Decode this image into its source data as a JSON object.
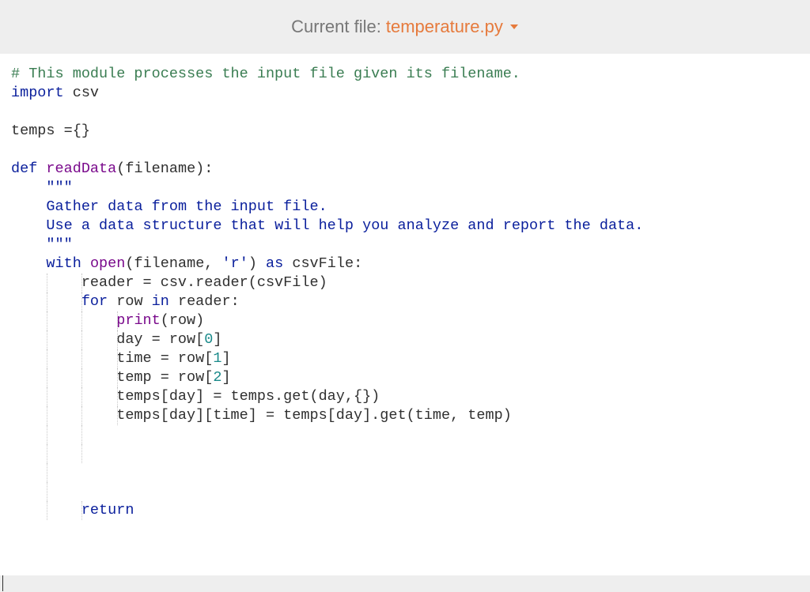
{
  "header": {
    "label": "Current file:",
    "filename": "temperature.py"
  },
  "code": {
    "lines": [
      [
        [
          "tok-comment",
          "# This module processes the input file given its filename."
        ]
      ],
      [
        [
          "tok-keyword",
          "import"
        ],
        [
          "tok-default",
          " csv"
        ]
      ],
      [],
      [
        [
          "tok-default",
          "temps ={}"
        ]
      ],
      [],
      [
        [
          "tok-keyword",
          "def"
        ],
        [
          "tok-default",
          " "
        ],
        [
          "tok-builtin",
          "readData"
        ],
        [
          "tok-default",
          "(filename):"
        ]
      ],
      [
        [
          "tok-default",
          "    "
        ],
        [
          "tok-string",
          "\"\"\""
        ]
      ],
      [
        [
          "tok-default",
          "    "
        ],
        [
          "tok-string",
          "Gather data from the input file."
        ]
      ],
      [
        [
          "tok-default",
          "    "
        ],
        [
          "tok-string",
          "Use a data structure that will help you analyze and report the data."
        ]
      ],
      [
        [
          "tok-default",
          "    "
        ],
        [
          "tok-string",
          "\"\"\""
        ]
      ],
      [
        [
          "tok-default",
          "    "
        ],
        [
          "tok-keyword",
          "with"
        ],
        [
          "tok-default",
          " "
        ],
        [
          "tok-builtin",
          "open"
        ],
        [
          "tok-default",
          "(filename, "
        ],
        [
          "tok-string",
          "'r'"
        ],
        [
          "tok-default",
          ") "
        ],
        [
          "tok-keyword",
          "as"
        ],
        [
          "tok-default",
          " csvFile:"
        ]
      ],
      [
        [
          "tok-default",
          "        reader = csv.reader(csvFile)"
        ]
      ],
      [
        [
          "tok-default",
          "        "
        ],
        [
          "tok-keyword",
          "for"
        ],
        [
          "tok-default",
          " row "
        ],
        [
          "tok-keyword",
          "in"
        ],
        [
          "tok-default",
          " reader:"
        ]
      ],
      [
        [
          "tok-default",
          "            "
        ],
        [
          "tok-builtin",
          "print"
        ],
        [
          "tok-default",
          "(row)"
        ]
      ],
      [
        [
          "tok-default",
          "            day = row["
        ],
        [
          "tok-num",
          "0"
        ],
        [
          "tok-default",
          "]"
        ]
      ],
      [
        [
          "tok-default",
          "            time = row["
        ],
        [
          "tok-num",
          "1"
        ],
        [
          "tok-default",
          "]"
        ]
      ],
      [
        [
          "tok-default",
          "            temp = row["
        ],
        [
          "tok-num",
          "2"
        ],
        [
          "tok-default",
          "]"
        ]
      ],
      [
        [
          "tok-default",
          "            temps[day] = temps.get(day,{})"
        ]
      ],
      [
        [
          "tok-default",
          "            temps[day][time] = temps[day].get(time, temp)"
        ]
      ],
      [],
      [
        [
          "tok-default",
          "        "
        ]
      ],
      [],
      [],
      [
        [
          "tok-default",
          "        "
        ],
        [
          "tok-keyword",
          "return"
        ]
      ],
      []
    ],
    "indent_guides": [
      {
        "line": 11,
        "cols": [
          4,
          8
        ]
      },
      {
        "line": 12,
        "cols": [
          4,
          8
        ]
      },
      {
        "line": 13,
        "cols": [
          4,
          8,
          12
        ]
      },
      {
        "line": 14,
        "cols": [
          4,
          8,
          12
        ]
      },
      {
        "line": 15,
        "cols": [
          4,
          8,
          12
        ]
      },
      {
        "line": 16,
        "cols": [
          4,
          8,
          12
        ]
      },
      {
        "line": 17,
        "cols": [
          4,
          8,
          12
        ]
      },
      {
        "line": 18,
        "cols": [
          4,
          8,
          12
        ]
      },
      {
        "line": 19,
        "cols": [
          4,
          8
        ]
      },
      {
        "line": 20,
        "cols": [
          4,
          8
        ]
      },
      {
        "line": 21,
        "cols": [
          4
        ]
      },
      {
        "line": 22,
        "cols": [
          4
        ]
      },
      {
        "line": 23,
        "cols": [
          4,
          8
        ]
      }
    ],
    "char_width": 11.15
  }
}
